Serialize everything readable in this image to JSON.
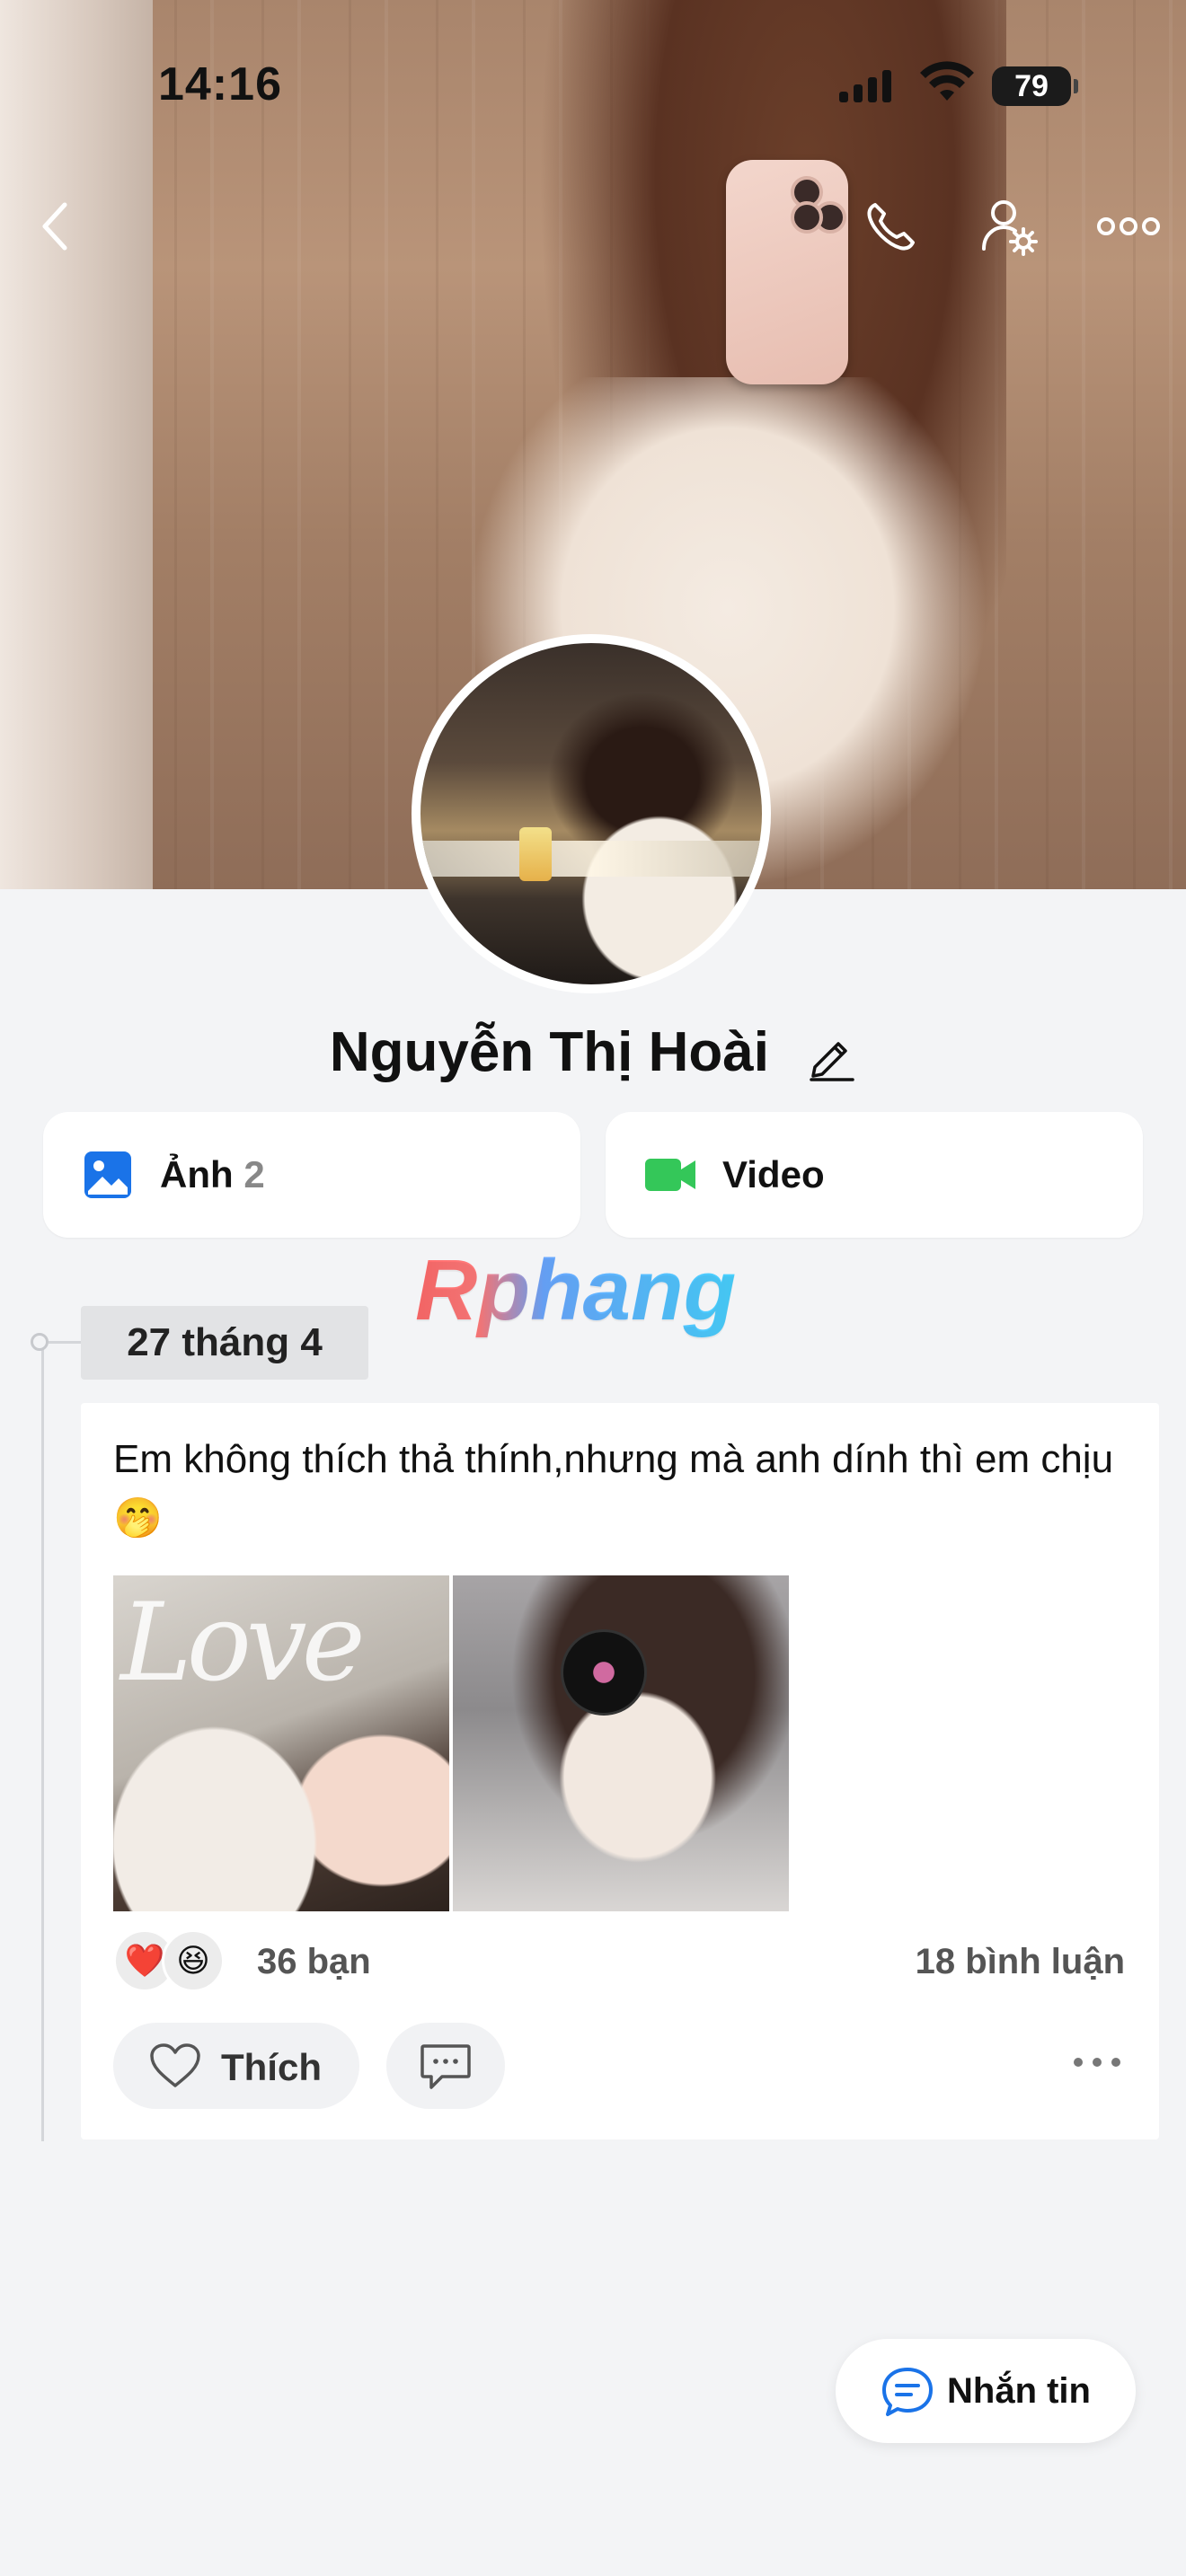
{
  "status_bar": {
    "time": "14:16",
    "battery": "79"
  },
  "profile": {
    "name": "Nguyễn Thị Hoài"
  },
  "media_tabs": [
    {
      "label": "Ảnh",
      "count": "2",
      "icon": "photo-icon",
      "color": "#1a73e8"
    },
    {
      "label": "Video",
      "count": "",
      "icon": "video-icon",
      "color": "#34c759"
    }
  ],
  "watermark": "Rphang",
  "timeline": {
    "date": "27 tháng 4"
  },
  "post": {
    "text": "Em không thích thả thính,nhưng mà anh dính thì em chịu🤭",
    "photo1_overlay": "Love",
    "reactions": [
      "❤️",
      "😆"
    ],
    "reaction_count": "36 bạn",
    "comment_count": "18 bình luận",
    "like_label": "Thích"
  },
  "message_button": {
    "label": "Nhắn tin"
  },
  "colors": {
    "accent": "#1a73e8",
    "background": "#f3f4f6"
  }
}
